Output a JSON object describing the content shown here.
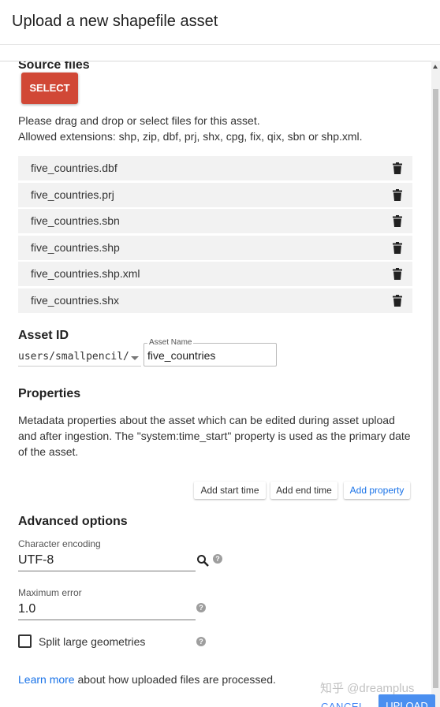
{
  "dialog": {
    "title": "Upload a new shapefile asset"
  },
  "source_files": {
    "heading": "Source files",
    "select_label": "SELECT",
    "instruction_line1": "Please drag and drop or select files for this asset.",
    "instruction_line2": "Allowed extensions: shp, zip, dbf, prj, shx, cpg, fix, qix, sbn or shp.xml.",
    "files": [
      {
        "name": "five_countries.dbf"
      },
      {
        "name": "five_countries.prj"
      },
      {
        "name": "five_countries.sbn"
      },
      {
        "name": "five_countries.shp"
      },
      {
        "name": "five_countries.shp.xml"
      },
      {
        "name": "five_countries.shx"
      }
    ],
    "delete_icon": "trash-icon"
  },
  "asset_id": {
    "heading": "Asset ID",
    "prefix": "users/smallpencil/",
    "name_label": "Asset Name",
    "name_value": "five_countries"
  },
  "properties": {
    "heading": "Properties",
    "description_line1": "Metadata properties about the asset which can be edited during asset upload",
    "description_line2": "and after ingestion. The \"system:time_start\" property is used as the primary date",
    "description_line3": "of the asset.",
    "add_start_time": "Add start time",
    "add_end_time": "Add end time",
    "add_property": "Add property"
  },
  "advanced": {
    "heading": "Advanced options",
    "encoding_label": "Character encoding",
    "encoding_value": "UTF-8",
    "max_error_label": "Maximum error",
    "max_error_value": "1.0",
    "split_label": "Split large geometries",
    "split_checked": false,
    "help_icon": "help-icon",
    "search_icon": "search-icon"
  },
  "footer": {
    "learn_more_link": "Learn more",
    "learn_more_rest": " about how uploaded files are processed.",
    "cancel_label": "CANCEL",
    "upload_label": "UPLOAD",
    "watermark": "知乎 @dreamplus"
  },
  "colors": {
    "select_button": "#d14836",
    "link": "#1a73e8",
    "upload_button": "#4a8ff0",
    "file_row_bg": "#f2f2f2"
  }
}
